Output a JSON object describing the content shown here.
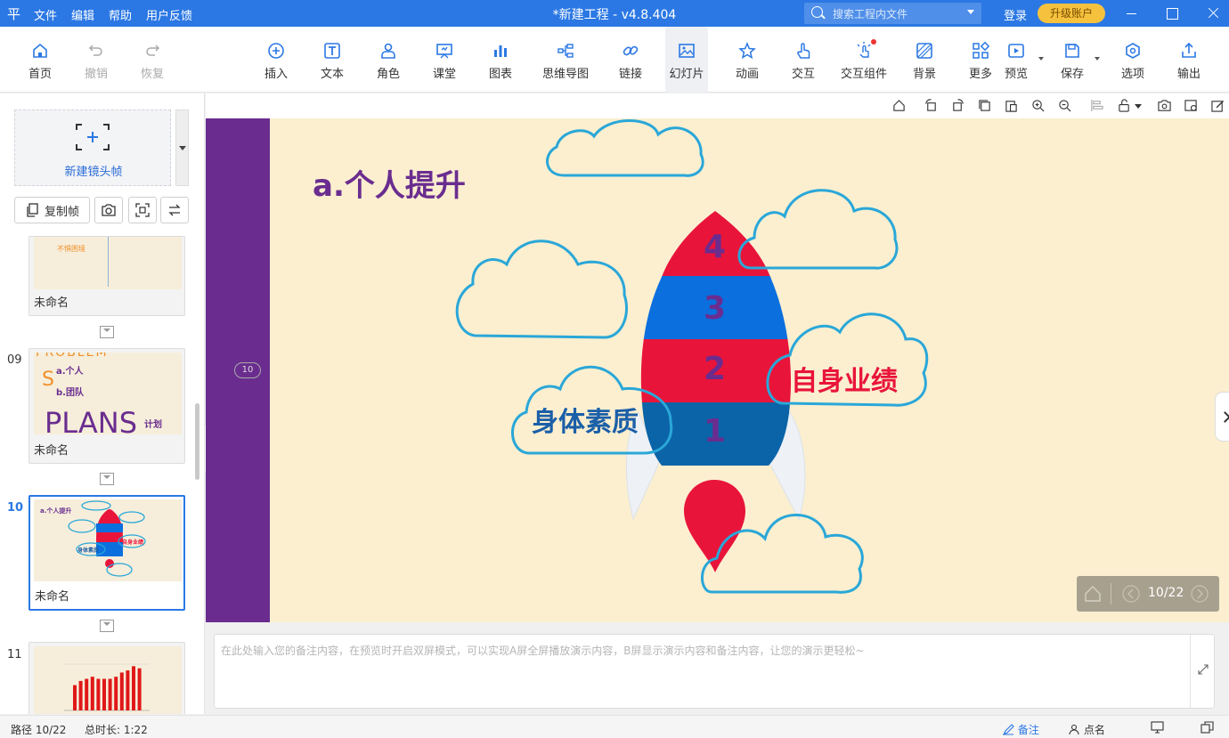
{
  "titlebar": {
    "logo": "平",
    "menu": [
      "文件",
      "编辑",
      "帮助",
      "用户反馈"
    ],
    "title": "*新建工程 - v4.8.404",
    "search_placeholder": "搜索工程内文件",
    "login": "登录",
    "upgrade": "升级账户"
  },
  "toolbar": {
    "home": "首页",
    "undo": "撤销",
    "redo": "恢复",
    "insert": "插入",
    "text": "文本",
    "role": "角色",
    "classroom": "课堂",
    "chart": "图表",
    "mindmap": "思维导图",
    "link": "链接",
    "slides": "幻灯片",
    "animation": "动画",
    "interact": "交互",
    "widgets": "交互组件",
    "background": "背景",
    "more": "更多",
    "preview": "预览",
    "save": "保存",
    "options": "选项",
    "export": "输出"
  },
  "sidebar": {
    "new_frame": "新建镜头帧",
    "copy_frame": "复制帧",
    "thumbs": [
      {
        "num": "",
        "name": "未命名",
        "snippet": "不惧困境"
      },
      {
        "num": "09",
        "name": "未命名",
        "t1": "a.个人",
        "t2": "b.团队",
        "t3": "PLANS",
        "t4": "计划",
        "t5": "S",
        "t6": "PROBLEM"
      },
      {
        "num": "10",
        "name": "未命名",
        "t1": "a.个人提升",
        "t2": "身体素质",
        "t3": "自身业绩"
      },
      {
        "num": "11",
        "name": "",
        "values": [
          6,
          7,
          7.5,
          8,
          7.5,
          7.5,
          7.5,
          8,
          9,
          9.5,
          10.5,
          10
        ]
      }
    ]
  },
  "slide": {
    "badge": "10",
    "title": "a.个人提升",
    "levels": [
      "4",
      "3",
      "2",
      "1"
    ],
    "left_label": "身体素质",
    "right_label": "自身业绩",
    "pager": "10/22"
  },
  "notes": {
    "placeholder": "在此处输入您的备注内容，在预览时开启双屏模式，可以实现A屏全屏播放演示内容，B屏显示演示内容和备注内容，让您的演示更轻松~"
  },
  "status": {
    "path": "路径 10/22",
    "duration": "总时长: 1:22",
    "notes": "备注",
    "rollcall": "点名"
  },
  "colors": {
    "accent": "#2b78e4",
    "purple": "#6a2d8f",
    "rocket_red": "#e9143a",
    "rocket_blue": "#0b6fde",
    "cloud": "#2aa7d8"
  }
}
